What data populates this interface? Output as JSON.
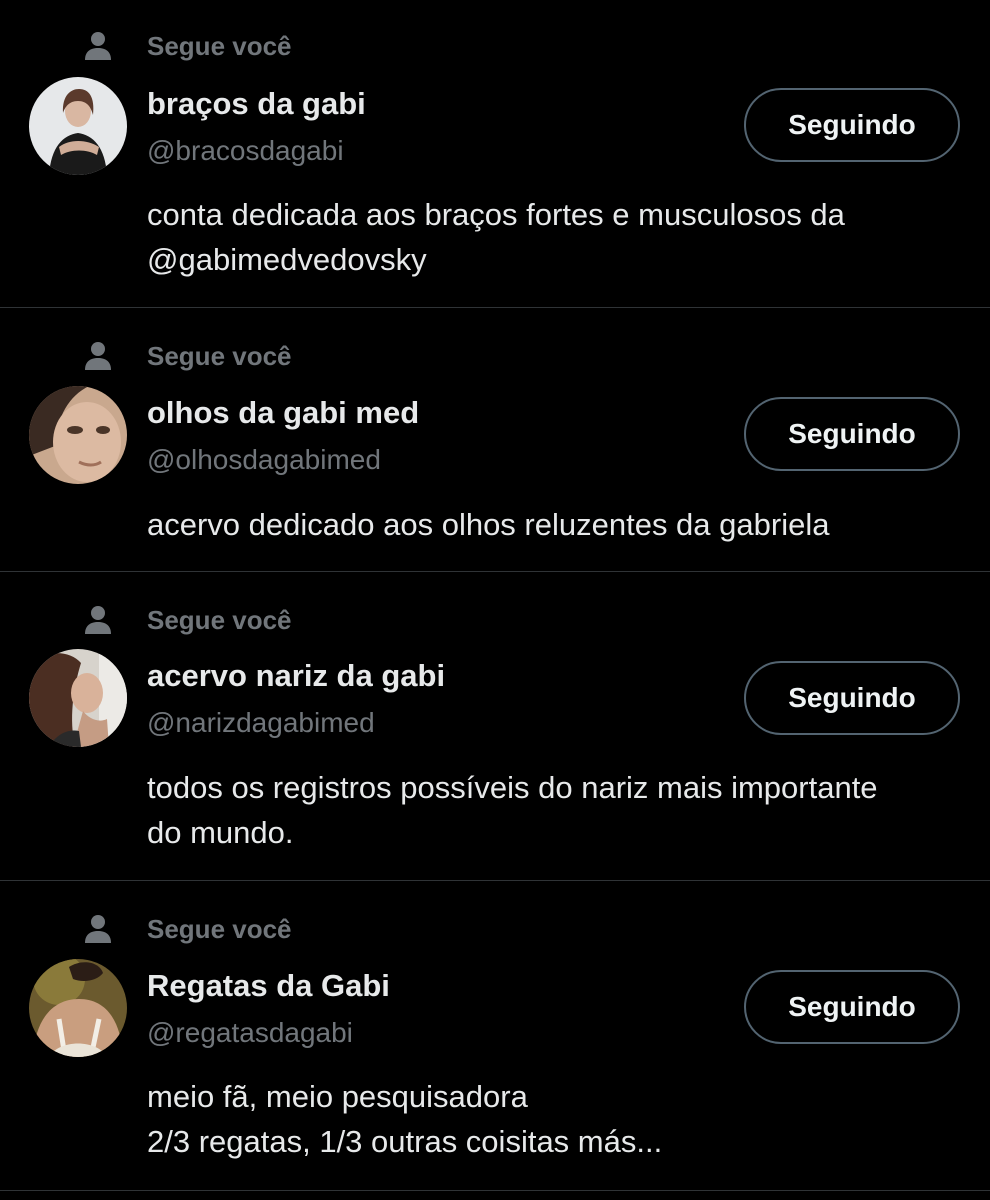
{
  "colors": {
    "background": "#000000",
    "primary_text": "#e7e9ea",
    "secondary_text": "#71767b",
    "divider": "#2f3336",
    "button_border": "#536471"
  },
  "accounts": [
    {
      "follows_you_icon": "person-icon",
      "follows_you": "Segue você",
      "display_name": "braços da gabi",
      "handle": "@bracosdagabi",
      "button_label": "Seguindo",
      "bio": [
        "conta dedicada aos braços fortes e musculosos da",
        "@gabimedvedovsky"
      ]
    },
    {
      "follows_you_icon": "person-icon",
      "follows_you": "Segue você",
      "display_name": "olhos da gabi med",
      "handle": "@olhosdagabimed",
      "button_label": "Seguindo",
      "bio": [
        "acervo dedicado aos olhos reluzentes da gabriela"
      ]
    },
    {
      "follows_you_icon": "person-icon",
      "follows_you": "Segue você",
      "display_name": "acervo nariz da gabi",
      "handle": "@narizdagabimed",
      "button_label": "Seguindo",
      "bio": [
        "todos os registros possíveis do nariz mais importante",
        "do mundo."
      ]
    },
    {
      "follows_you_icon": "person-icon",
      "follows_you": "Segue você",
      "display_name": "Regatas da Gabi",
      "handle": "@regatasdagabi",
      "button_label": "Seguindo",
      "bio": [
        "meio fã, meio pesquisadora",
        "2/3 regatas, 1/3 outras coisitas más..."
      ]
    }
  ]
}
